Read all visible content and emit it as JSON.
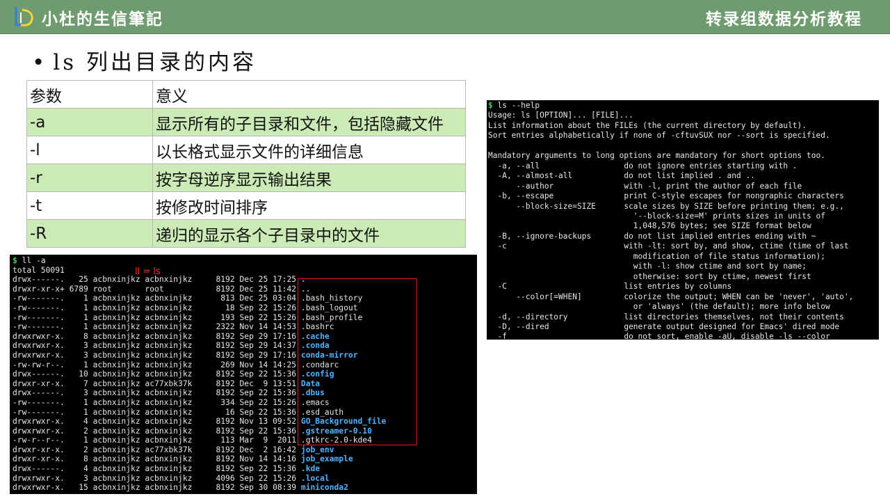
{
  "header": {
    "brand": "小杜的生信筆記",
    "topic": "转录组数据分析教程",
    "logo_icon": "ld-logo-icon",
    "bar_color": "#6f9c6f"
  },
  "slide": {
    "bullet": "•",
    "title": "ls 列出目录的内容"
  },
  "params_table": {
    "headers": [
      "参数",
      "意义"
    ],
    "rows": [
      {
        "param": "-a",
        "meaning": "显示所有的子目录和文件，包括隐藏文件"
      },
      {
        "param": "-l",
        "meaning": "以长格式显示文件的详细信息"
      },
      {
        "param": "-r",
        "meaning": "按字母逆序显示输出结果"
      },
      {
        "param": "-t",
        "meaning": "按修改时间排序"
      },
      {
        "param": "-R",
        "meaning": "递归的显示各个子目录中的文件"
      }
    ],
    "highlight_color": "#cbeab6"
  },
  "terminal_ll": {
    "prompt": "$",
    "command": "ll -a",
    "annotation": "ll = ls",
    "total": "total 50091",
    "entries": [
      {
        "perms": "drwx------.",
        "links": "25",
        "owner": "acbnxinjkz",
        "group": "acbnxinjkz",
        "size": "8192",
        "date": "Dec 25 17:25",
        "name": ".",
        "dir": true
      },
      {
        "perms": "drwxr-xr-x+",
        "links": "6789",
        "owner": "root",
        "group": "root",
        "size": "8192",
        "date": "Dec 25 11:42",
        "name": "..",
        "dir": true
      },
      {
        "perms": "-rw-------.",
        "links": "1",
        "owner": "acbnxinjkz",
        "group": "acbnxinjkz",
        "size": "813",
        "date": "Dec 25 03:04",
        "name": ".bash_history",
        "dir": false
      },
      {
        "perms": "-rw-------.",
        "links": "1",
        "owner": "acbnxinjkz",
        "group": "acbnxinjkz",
        "size": "18",
        "date": "Sep 22 15:26",
        "name": ".bash_logout",
        "dir": false
      },
      {
        "perms": "-rw-------.",
        "links": "1",
        "owner": "acbnxinjkz",
        "group": "acbnxinjkz",
        "size": "193",
        "date": "Sep 22 15:26",
        "name": ".bash_profile",
        "dir": false
      },
      {
        "perms": "-rw-------.",
        "links": "1",
        "owner": "acbnxinjkz",
        "group": "acbnxinjkz",
        "size": "2322",
        "date": "Nov 14 14:53",
        "name": ".bashrc",
        "dir": false
      },
      {
        "perms": "drwxrwxr-x.",
        "links": "8",
        "owner": "acbnxinjkz",
        "group": "acbnxinjkz",
        "size": "8192",
        "date": "Sep 29 17:16",
        "name": ".cache",
        "dir": true
      },
      {
        "perms": "drwxrwxr-x.",
        "links": "3",
        "owner": "acbnxinjkz",
        "group": "acbnxinjkz",
        "size": "8192",
        "date": "Sep 29 14:37",
        "name": ".conda",
        "dir": true
      },
      {
        "perms": "drwxrwxr-x.",
        "links": "3",
        "owner": "acbnxinjkz",
        "group": "acbnxinjkz",
        "size": "8192",
        "date": "Sep 29 17:16",
        "name": "conda-mirror",
        "dir": true
      },
      {
        "perms": "-rw-rw-r--.",
        "links": "1",
        "owner": "acbnxinjkz",
        "group": "acbnxinjkz",
        "size": "269",
        "date": "Nov 14 14:25",
        "name": ".condarc",
        "dir": false
      },
      {
        "perms": "drwx------.",
        "links": "10",
        "owner": "acbnxinjkz",
        "group": "acbnxinjkz",
        "size": "8192",
        "date": "Sep 22 15:36",
        "name": ".config",
        "dir": true
      },
      {
        "perms": "drwxr-xr-x.",
        "links": "7",
        "owner": "acbnxinjkz",
        "group": "ac77xbk37k",
        "size": "8192",
        "date": "Dec  9 13:51",
        "name": "Data",
        "dir": true
      },
      {
        "perms": "drwx------.",
        "links": "3",
        "owner": "acbnxinjkz",
        "group": "acbnxinjkz",
        "size": "8192",
        "date": "Sep 22 15:36",
        "name": ".dbus",
        "dir": true
      },
      {
        "perms": "-rw-------.",
        "links": "1",
        "owner": "acbnxinjkz",
        "group": "acbnxinjkz",
        "size": "334",
        "date": "Sep 22 15:26",
        "name": ".emacs",
        "dir": false
      },
      {
        "perms": "-rw-------.",
        "links": "1",
        "owner": "acbnxinjkz",
        "group": "acbnxinjkz",
        "size": "16",
        "date": "Sep 22 15:36",
        "name": ".esd_auth",
        "dir": false
      },
      {
        "perms": "drwxrwxr-x.",
        "links": "4",
        "owner": "acbnxinjkz",
        "group": "acbnxinjkz",
        "size": "8192",
        "date": "Nov 13 09:52",
        "name": "GO_Background_file",
        "dir": true
      },
      {
        "perms": "drwxrwxr-x.",
        "links": "2",
        "owner": "acbnxinjkz",
        "group": "acbnxinjkz",
        "size": "8192",
        "date": "Sep 22 15:36",
        "name": ".gstreamer-0.10",
        "dir": true
      },
      {
        "perms": "-rw-r--r--.",
        "links": "1",
        "owner": "acbnxinjkz",
        "group": "acbnxinjkz",
        "size": "113",
        "date": "Mar  9  2011",
        "name": ".gtkrc-2.0-kde4",
        "dir": false
      },
      {
        "perms": "drwxr-xr-x.",
        "links": "2",
        "owner": "acbnxinjkz",
        "group": "ac77xbk37k",
        "size": "8192",
        "date": "Dec  2 16:42",
        "name": "job_env",
        "dir": true
      },
      {
        "perms": "drwxr-xr-x.",
        "links": "8",
        "owner": "acbnxinjkz",
        "group": "acbnxinjkz",
        "size": "8192",
        "date": "Nov 14 14:16",
        "name": "job_example",
        "dir": true
      },
      {
        "perms": "drwx------.",
        "links": "4",
        "owner": "acbnxinjkz",
        "group": "acbnxinjkz",
        "size": "8192",
        "date": "Sep 22 15:36",
        "name": ".kde",
        "dir": true
      },
      {
        "perms": "drwxrwxr-x.",
        "links": "3",
        "owner": "acbnxinjkz",
        "group": "acbnxinjkz",
        "size": "4096",
        "date": "Sep 22 15:26",
        "name": ".local",
        "dir": true
      },
      {
        "perms": "drwxrwxr-x.",
        "links": "15",
        "owner": "acbnxinjkz",
        "group": "acbnxinjkz",
        "size": "8192",
        "date": "Sep 30 08:39",
        "name": "miniconda2",
        "dir": true
      }
    ],
    "dir_color": "#4fb3ff",
    "box_color": "#e02020"
  },
  "terminal_help": {
    "prompt": "$",
    "command": "ls --help",
    "lines": [
      "Usage: ls [OPTION]... [FILE]...",
      "List information about the FILEs (the current directory by default).",
      "Sort entries alphabetically if none of -cftuvSUX nor --sort is specified.",
      "",
      "Mandatory arguments to long options are mandatory for short options too.",
      "  -a, --all                  do not ignore entries starting with .",
      "  -A, --almost-all           do not list implied . and ..",
      "      --author               with -l, print the author of each file",
      "  -b, --escape               print C-style escapes for nongraphic characters",
      "      --block-size=SIZE      scale sizes by SIZE before printing them; e.g.,",
      "                               '--block-size=M' prints sizes in units of",
      "                               1,048,576 bytes; see SIZE format below",
      "  -B, --ignore-backups       do not list implied entries ending with ~",
      "  -c                         with -lt: sort by, and show, ctime (time of last",
      "                               modification of file status information);",
      "                               with -l: show ctime and sort by name;",
      "                               otherwise: sort by ctime, newest first",
      "  -C                         list entries by columns",
      "      --color[=WHEN]         colorize the output; WHEN can be 'never', 'auto',",
      "                               or 'always' (the default); more info below",
      "  -d, --directory            list directories themselves, not their contents",
      "  -D, --dired                generate output designed for Emacs' dired mode",
      "  -f                         do not sort, enable -aU, disable -ls --color"
    ]
  }
}
